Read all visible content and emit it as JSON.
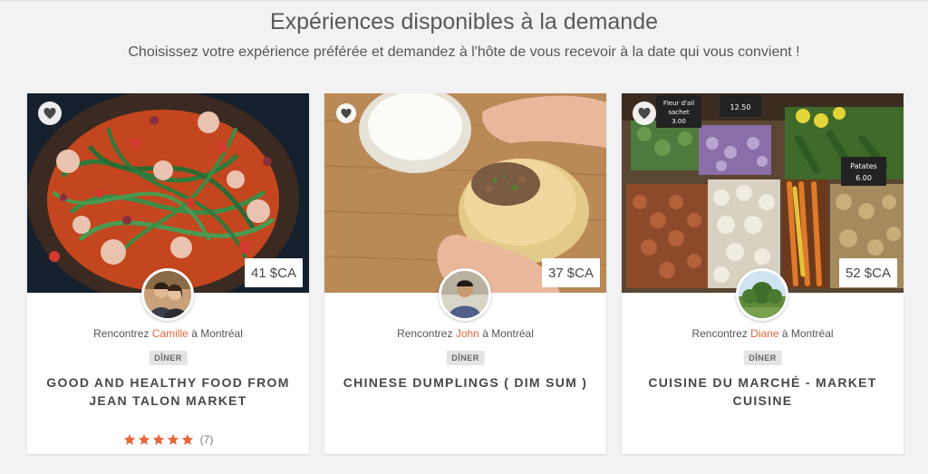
{
  "header": {
    "title": "Expériences disponibles à la demande",
    "subtitle": "Choisissez votre expérience préférée et demandez à l'hôte de vous recevoir à la date qui vous convient !"
  },
  "colors": {
    "host_name": "#e8663a",
    "star": "#e8663a"
  },
  "cards": [
    {
      "price": "41 $CA",
      "meet_prefix": "Rencontrez",
      "host": "Camille",
      "meet_suffix": "à Montréal",
      "tag": "DÎNER",
      "title": "GOOD AND HEALTHY FOOD FROM JEAN TALON MARKET",
      "rating": 5,
      "review_count": "(7)",
      "image": "pasta-with-octopus-photo",
      "avatar": "couple-avatar"
    },
    {
      "price": "37 $CA",
      "meet_prefix": "Rencontrez",
      "host": "John",
      "meet_suffix": "à Montréal",
      "tag": "DÎNER",
      "title": "CHINESE DUMPLINGS ( DIM SUM )",
      "image": "dumpling-making-photo",
      "avatar": "man-avatar"
    },
    {
      "price": "52 $CA",
      "meet_prefix": "Rencontrez",
      "host": "Diane",
      "meet_suffix": "à Montréal",
      "tag": "DÎNER",
      "title": "CUISINE DU MARCHÉ - MARKET CUISINE",
      "image": "market-vegetables-photo",
      "avatar": "garden-avatar",
      "signs": [
        "Fleur d'ail",
        "sachet",
        "3.00",
        "12.50",
        "Patates",
        "6.00"
      ]
    }
  ]
}
